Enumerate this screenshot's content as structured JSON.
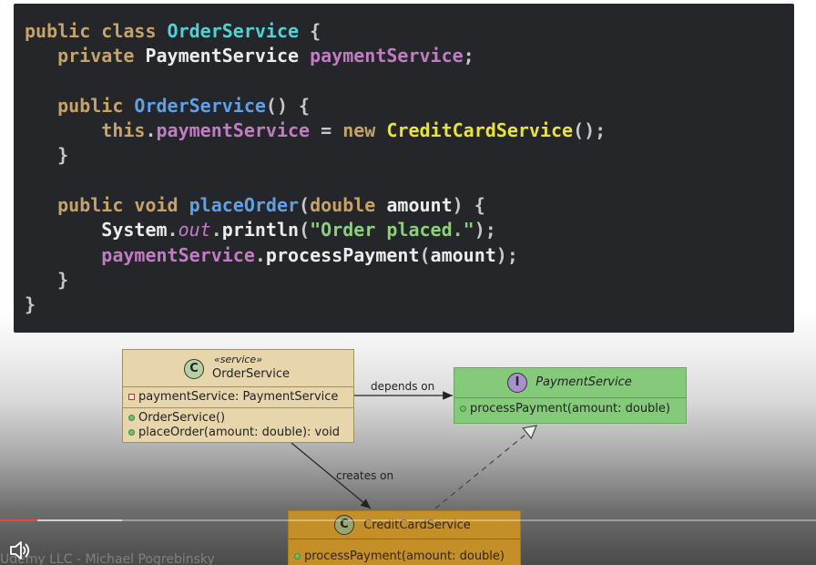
{
  "code": {
    "lines": [
      [
        [
          "kw",
          "public class "
        ],
        [
          "cls",
          "OrderService"
        ],
        [
          "pun",
          " {"
        ]
      ],
      [
        [
          "kw",
          "   private "
        ],
        [
          "wht",
          "PaymentService "
        ],
        [
          "fld",
          "paymentService"
        ],
        [
          "pun",
          ";"
        ]
      ],
      [],
      [
        [
          "kw",
          "   public "
        ],
        [
          "fn",
          "OrderService"
        ],
        [
          "pun",
          "() {"
        ]
      ],
      [
        [
          "kw",
          "       this"
        ],
        [
          "pun",
          "."
        ],
        [
          "fld",
          "paymentService"
        ],
        [
          "pun",
          " = "
        ],
        [
          "kw",
          "new "
        ],
        [
          "yel",
          "CreditCardService"
        ],
        [
          "pun",
          "();"
        ]
      ],
      [
        [
          "pun",
          "   }"
        ]
      ],
      [],
      [
        [
          "kw",
          "   public void "
        ],
        [
          "fn",
          "placeOrder"
        ],
        [
          "pun",
          "("
        ],
        [
          "kw",
          "double "
        ],
        [
          "wht",
          "amount"
        ],
        [
          "pun",
          ") {"
        ]
      ],
      [
        [
          "wht",
          "       System"
        ],
        [
          "pun",
          "."
        ],
        [
          "it",
          "out"
        ],
        [
          "pun",
          "."
        ],
        [
          "wht",
          "println"
        ],
        [
          "pun",
          "("
        ],
        [
          "str",
          "\"Order placed.\""
        ],
        [
          "pun",
          ");"
        ]
      ],
      [
        [
          "fld",
          "       paymentService"
        ],
        [
          "pun",
          "."
        ],
        [
          "wht",
          "processPayment"
        ],
        [
          "pun",
          "("
        ],
        [
          "wht",
          "amount"
        ],
        [
          "pun",
          ");"
        ]
      ],
      [
        [
          "pun",
          "   }"
        ]
      ],
      [
        [
          "pun",
          "}"
        ]
      ]
    ]
  },
  "uml": {
    "order_service": {
      "badge": "C",
      "stereotype": "«service»",
      "name": "OrderService",
      "fields": [
        "paymentService: PaymentService"
      ],
      "methods": [
        "OrderService()",
        "placeOrder(amount: double): void"
      ]
    },
    "payment_service": {
      "badge": "I",
      "name": "PaymentService",
      "methods": [
        "processPayment(amount: double)"
      ]
    },
    "credit_card_service": {
      "badge": "C",
      "name": "CreditCardService",
      "methods": [
        "processPayment(amount: double)"
      ]
    },
    "relations": {
      "depends_on": "depends on",
      "creates_on": "creates on"
    }
  },
  "player": {
    "progress_played": 0.046,
    "progress_buffered": 0.15,
    "credit": "Udemy LLC - Michael Pogrebinsky",
    "volume_icon": "speaker-icon"
  }
}
